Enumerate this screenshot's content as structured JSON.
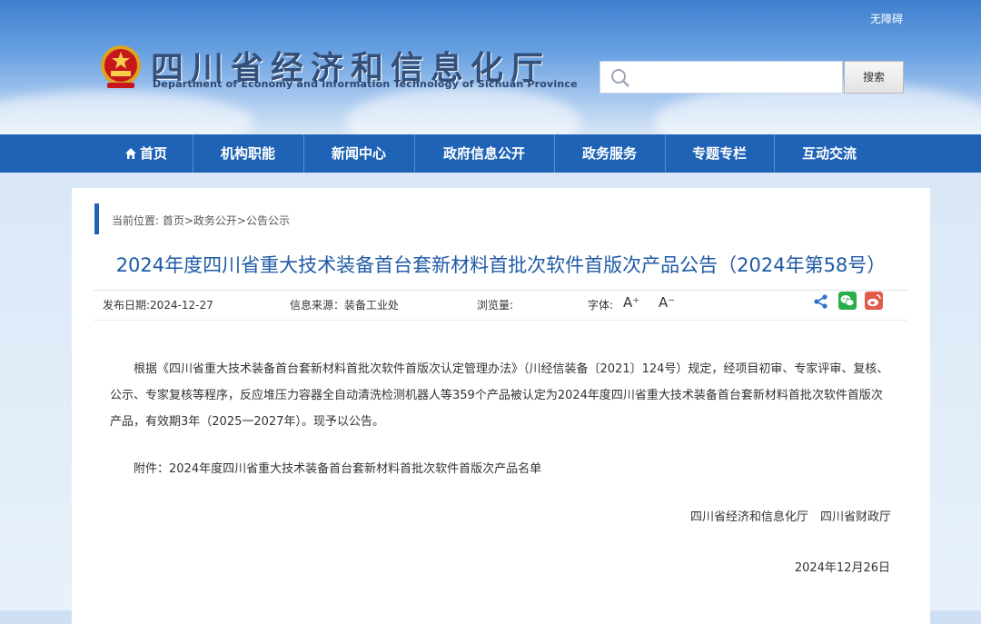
{
  "header": {
    "accessibility_label": "无障碍",
    "site_title_cn": "四川省经济和信息化厅",
    "site_title_en": "Department of Economy and Information Technology of Sichuan Province",
    "search": {
      "value": "",
      "placeholder": "",
      "button_label": "搜索"
    }
  },
  "nav": {
    "items": [
      {
        "label": "首页",
        "icon": "home-icon"
      },
      {
        "label": "机构职能"
      },
      {
        "label": "新闻中心"
      },
      {
        "label": "政府信息公开"
      },
      {
        "label": "政务服务"
      },
      {
        "label": "专题专栏"
      },
      {
        "label": "互动交流"
      }
    ],
    "background_color": "#1f63b6"
  },
  "breadcrumb": "当前位置: 首页>政务公开>公告公示",
  "article": {
    "title": "2024年度四川省重大技术装备首台套新材料首批次软件首版次产品公告（2024年第58号）",
    "meta": {
      "publish_date": "发布日期:2024-12-27",
      "source": "信息来源：装备工业处",
      "views": "浏览量:",
      "font_label": "字体:",
      "font_larger": "A⁺",
      "font_smaller": "A⁻"
    },
    "share_icons": [
      "share-icon",
      "wechat-icon",
      "weibo-icon"
    ],
    "paragraph_1": "根据《四川省重大技术装备首台套新材料首批次软件首版次认定管理办法》（川经信装备〔2021〕124号）规定，经项目初审、专家评审、复核、公示、专家复核等程序，反应堆压力容器全自动清洗检测机器人等359个产品被认定为2024年度四川省重大技术装备首台套新材料首批次软件首版次产品，有效期3年（2025一2027年）。现予以公告。",
    "paragraph_2": "附件：2024年度四川省重大技术装备首台套新材料首批次软件首版次产品名单",
    "signature": "四川省经济和信息化厅　四川省财政厅",
    "sign_date": "2024年12月26日"
  }
}
